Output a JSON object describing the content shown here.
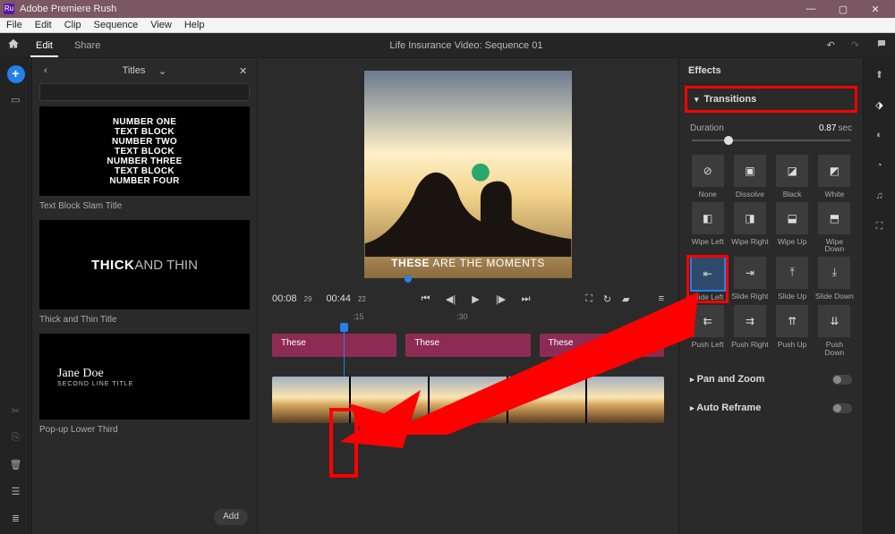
{
  "titlebar": {
    "app_name": "Adobe Premiere Rush"
  },
  "menubar": [
    "File",
    "Edit",
    "Clip",
    "Sequence",
    "View",
    "Help"
  ],
  "appbar": {
    "tabs": {
      "edit": "Edit",
      "share": "Share"
    },
    "sequence_title": "Life Insurance Video: Sequence 01"
  },
  "left_panel": {
    "title": "Titles",
    "search_placeholder": "",
    "cards": [
      {
        "lines": [
          "NUMBER ONE",
          "TEXT BLOCK",
          "NUMBER TWO",
          "TEXT BLOCK",
          "NUMBER THREE",
          "TEXT BLOCK",
          "NUMBER FOUR"
        ],
        "label": "Text Block Slam Title"
      },
      {
        "thick_bold": "THICK",
        "thick_thin": "AND THIN",
        "label": "Thick and Thin Title"
      },
      {
        "name": "Jane Doe",
        "second": "SECOND LINE TITLE",
        "label": "Pop-up Lower Third"
      }
    ],
    "add_button": "Add"
  },
  "preview": {
    "caption_bold": "THESE",
    "caption_light": " ARE THE MOMENTS"
  },
  "timebar": {
    "current": "00:08",
    "current_frames": "29",
    "total": "00:44",
    "total_frames": "22"
  },
  "ruler": [
    ":15",
    ":30"
  ],
  "title_clips": [
    "These",
    "These",
    "These"
  ],
  "effects_panel": {
    "header": "Effects",
    "sections": {
      "transitions": "Transitions",
      "pan_zoom": "Pan and Zoom",
      "auto_reframe": "Auto Reframe"
    },
    "duration_label": "Duration",
    "duration_value": "0.87",
    "duration_unit": "sec",
    "transitions": [
      {
        "name": "None",
        "glyph": "⊘"
      },
      {
        "name": "Dissolve",
        "glyph": "▣"
      },
      {
        "name": "Black",
        "glyph": "◪"
      },
      {
        "name": "White",
        "glyph": "◩"
      },
      {
        "name": "Wipe Left",
        "glyph": "◧"
      },
      {
        "name": "Wipe Right",
        "glyph": "◨"
      },
      {
        "name": "Wipe Up",
        "glyph": "⬓"
      },
      {
        "name": "Wipe Down",
        "glyph": "⬒"
      },
      {
        "name": "Slide Left",
        "glyph": "⇤",
        "selected": true,
        "boxed": true
      },
      {
        "name": "Slide Right",
        "glyph": "⇥"
      },
      {
        "name": "Slide Up",
        "glyph": "⤒"
      },
      {
        "name": "Slide Down",
        "glyph": "⤓"
      },
      {
        "name": "Push Left",
        "glyph": "⇇"
      },
      {
        "name": "Push Right",
        "glyph": "⇉"
      },
      {
        "name": "Push Up",
        "glyph": "⇈"
      },
      {
        "name": "Push Down",
        "glyph": "⇊"
      }
    ]
  }
}
